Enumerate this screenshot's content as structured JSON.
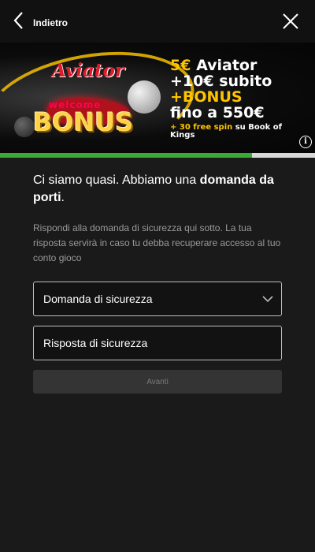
{
  "header": {
    "back_label": "Indietro"
  },
  "banner": {
    "logo_aviator": "Aviator",
    "logo_welcome": "welcome",
    "logo_bonus": "BONUS",
    "promo_amount1": "5€",
    "promo_line1_rest": " Aviator",
    "promo_line2": "+10€ subito",
    "promo_line3": "+BONUS",
    "promo_line4": "fino a 550€",
    "promo_line5_prefix": "+ 30 free spin ",
    "promo_line5_mid": "su",
    "promo_line5_suffix": " Book of Kings",
    "info_symbol": "i"
  },
  "progress": {
    "fraction": 0.8,
    "fill_color": "#3aa935"
  },
  "form": {
    "headline_part1": "Ci siamo quasi. Abbiamo una ",
    "headline_bold": "domanda da porti",
    "headline_end": ".",
    "description": "Rispondi alla domanda di sicurezza qui sotto. La tua risposta servirà in caso tu debba recuperare accesso al tuo conto gioco",
    "question_select_label": "Domanda di sicurezza",
    "answer_field_label": "Risposta di sicurezza",
    "submit_label": "Avanti"
  },
  "icons": {
    "back": "chevron-left-icon",
    "close": "close-icon",
    "dropdown": "chevron-down-icon",
    "info": "info-icon"
  }
}
